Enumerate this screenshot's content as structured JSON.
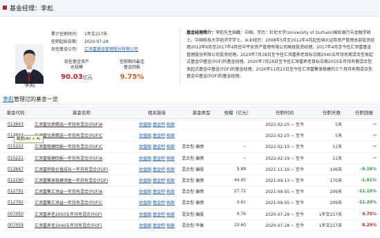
{
  "header": {
    "title": "基金经理：李彪"
  },
  "manager": {
    "name": "李彪",
    "fields": [
      {
        "label": "累计任职时间：",
        "value": "1年又217天"
      },
      {
        "label": "任职起始日期：",
        "value": "2020-07-28"
      },
      {
        "label": "现任基金公司：",
        "value": "汇添富基金管理股份有限公司"
      }
    ],
    "stats": [
      {
        "label1": "现任基金资产",
        "label2": "总规模",
        "value": "90.03",
        "unit": "亿元",
        "color": "#c01f1f"
      },
      {
        "label1": "任职期间最佳",
        "label2": "基金回报",
        "value": "9.75%",
        "unit": "",
        "color": "#e8590c"
      }
    ],
    "bio_heading": "基金经理简介：",
    "bio_text": "李彪先生国籍：中国，学历：杜伦大学(University of Durham)国际银行与金融学硕士，中国科技大学经济学学士。从业经历：2008年5月至2012年4月起任国元证券资产管理总部投资经理2012年6月至2017年4月任中平安资产管理有限公司高级投资经理。2017年4月至今任汇添富基金管理股份有限公司投资经理。2020年7月28日至今任汇添富养老目标日期2040五年持有期混合型发起式基金中基金(FOF)的基金经理。2020年7月28日至今任汇添富养老目标日期2050五年持有期混合型发起式基金中基金(FOF)的基金经理。2020年11月23日至今任汇添富聚享稳健的三个月持有期混合型基金中基金(FOF)的基金经理。"
  },
  "section": {
    "link": "李彪",
    "rest": "管理过的基金一览"
  },
  "table": {
    "headers": [
      "基金代码",
      "基金名称",
      "相关链接",
      "基金类型",
      "规模（亿元）",
      "任职时间",
      "任职天数",
      "任职回报"
    ],
    "action_labels": [
      "估值图",
      "基金吧",
      "档案"
    ],
    "rows": [
      {
        "code": "013643",
        "name": "汇添富优质精选一年持有混合(FOF)A",
        "type": "",
        "size": "",
        "period": "2022-02-25 ~ 至今",
        "days": "5天",
        "ret": "--",
        "ret_color": "#333333"
      },
      {
        "code": "013644",
        "name": "汇添富优质精选一年持有混合(FOF)C",
        "type": "",
        "size": "",
        "period": "2022-02-25 ~ 至今",
        "days": "5天",
        "ret": "--",
        "ret_color": "#333333"
      },
      {
        "code": "015222",
        "name": "汇添富稳健回报一年持有混合(FOF)C",
        "type": "混合型-偏债",
        "size": "--",
        "period": "2022-02-19 ~ 至今",
        "days": "11天",
        "ret": "--",
        "ret_color": "#333333"
      },
      {
        "code": "015221",
        "name": "汇添富稳健回报一年持有混合(FOF)A",
        "type": "混合型-偏债",
        "size": "--",
        "period": "2022-02-19 ~ 至今",
        "days": "11天",
        "ret": "--",
        "ret_color": "#333333"
      },
      {
        "code": "013647",
        "name": "汇添富积极价值成长一年持有混合(FOF)",
        "type": "混合型-偏股",
        "size": "5.89",
        "period": "2021-11-16 ~ 至今",
        "days": "106天",
        "ret": "-9.16%",
        "ret_color": "#1f9d3a"
      },
      {
        "code": "012190",
        "name": "汇添富聚享稳健添盈一年持有混合(FOF)",
        "type": "混合型-偏债",
        "size": "44.45",
        "period": "2021-09-13 ~ 至今",
        "days": "170天",
        "ret": "-1.61%",
        "ret_color": "#1f9d3a"
      },
      {
        "code": "012791",
        "name": "汇添富聚汇添益一年持有混合(FOF)A",
        "type": "混合型-偏债",
        "size": "27.72",
        "period": "2021-08-05 ~ 至今",
        "days": "209天",
        "ret": "-11.10%",
        "ret_color": "#1f9d3a"
      },
      {
        "code": "012792",
        "name": "汇添富聚汇添益一年持有混合(FOF)C",
        "type": "混合型-偏债",
        "size": "0.61",
        "period": "2021-08-05 ~ 至今",
        "days": "209天",
        "ret": "-11.29%",
        "ret_color": "#1f9d3a"
      },
      {
        "code": "007050",
        "name": "汇添富养老2050五年持有混合(FOF)",
        "type": "混合型-偏股",
        "size": "0.76",
        "period": "2020-07-28 ~ 至今",
        "days": "1年又217天",
        "ret": "9.75%",
        "ret_color": "#c01f1f"
      },
      {
        "code": "007059",
        "name": "汇添富养老2040五年持有混合(FOF)",
        "type": "混合型-平衡",
        "size": "10.60",
        "period": "2020-07-28 ~ 至今",
        "days": "1年又217天",
        "ret": "8.29%",
        "ret_color": "#c01f1f"
      }
    ]
  },
  "tooltip": {
    "text": "截图(Alt + A)"
  }
}
